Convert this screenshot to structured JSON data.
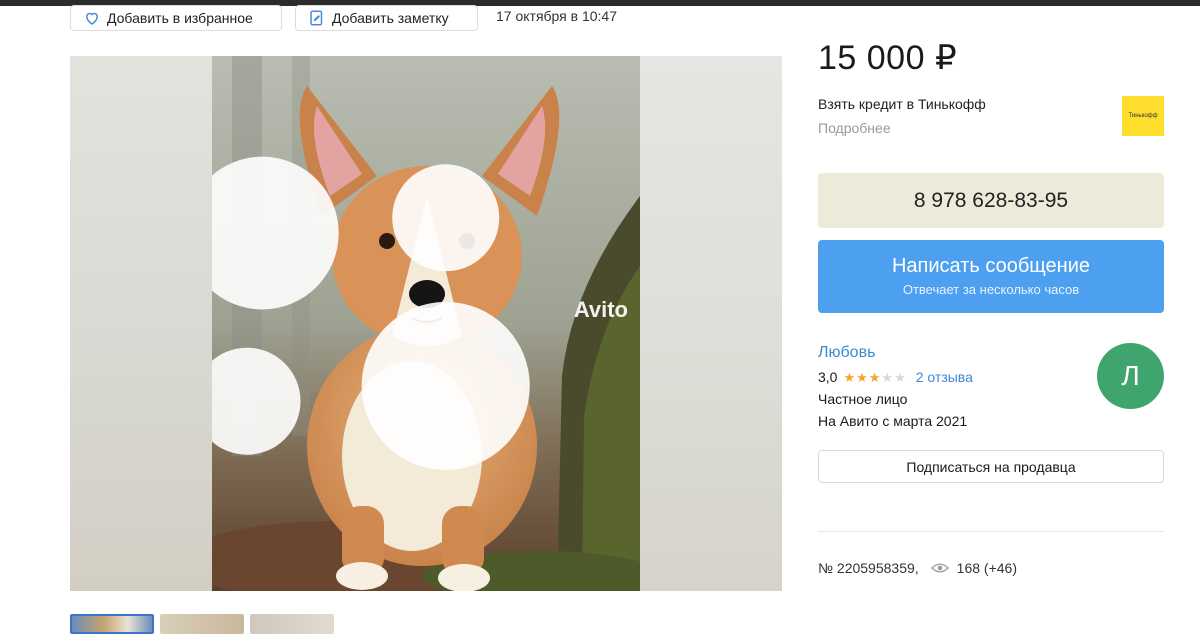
{
  "actions": {
    "favorite_label": "Добавить в избранное",
    "note_label": "Добавить заметку",
    "date": "17 октября в 10:47"
  },
  "gallery": {
    "watermark": "Avito"
  },
  "listing": {
    "price": "15 000 ₽",
    "credit_label": "Взять кредит в Тинькофф",
    "credit_more": "Подробнее",
    "bank_logo_text": "Тинькофф"
  },
  "contact": {
    "phone": "8 978 628-83-95",
    "message_label": "Написать сообщение",
    "message_sub": "Отвечает за несколько часов"
  },
  "seller": {
    "name": "Любовь",
    "rating": "3,0",
    "rating_value": 3,
    "rating_max": 5,
    "reviews": "2 отзыва",
    "type": "Частное лицо",
    "since": "На Авито с марта 2021",
    "avatar_letter": "Л",
    "avatar_color": "#3fa46e",
    "subscribe_label": "Подписаться на продавца"
  },
  "meta": {
    "ad_number": "№ 2205958359,",
    "views": "168 (+46)"
  },
  "colors": {
    "accent_blue": "#4d9ff0",
    "phone_bg": "#ecead8",
    "link_blue": "#3a8ad0",
    "star": "#f5a623"
  }
}
